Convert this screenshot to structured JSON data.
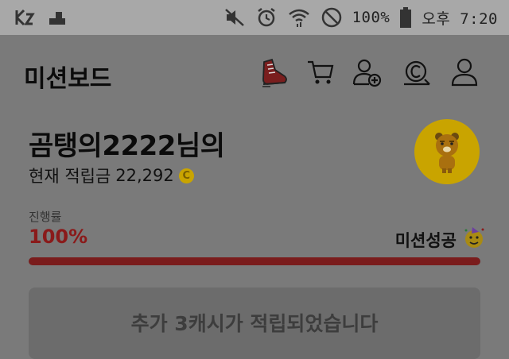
{
  "status_bar": {
    "battery_text": "100%",
    "time_text": "오후 7:20",
    "icons": [
      "k-app-icon",
      "signal-app-icon",
      "mute-icon",
      "alarm-icon",
      "wifi-icon",
      "do-not-disturb-icon",
      "battery-icon"
    ]
  },
  "header": {
    "title": "미션보드",
    "icons": [
      "sneaker-icon",
      "cart-icon",
      "add-friend-icon",
      "cash-icon",
      "profile-icon"
    ]
  },
  "summary": {
    "greeting": "곰탱의2222님의",
    "cash_label": "현재 적립금",
    "cash_value": "22,292",
    "coin_glyph": "C"
  },
  "progress": {
    "label": "진행률",
    "value_text": "100%",
    "fill_fraction": 1.0,
    "status": "미션성공",
    "status_icon": "party-face-icon"
  },
  "reward": {
    "message": "추가 3캐시가 적립되었습니다"
  },
  "colors": {
    "accent_red": "#7a1c1c",
    "coin_gold": "#c9a400"
  }
}
